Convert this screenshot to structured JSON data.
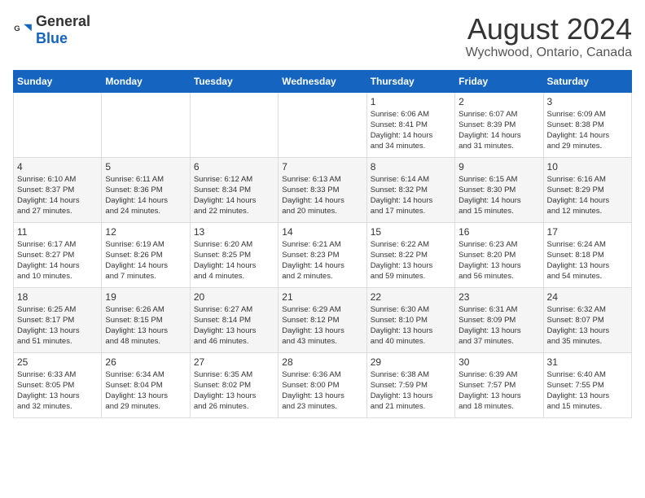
{
  "header": {
    "logo_general": "General",
    "logo_blue": "Blue",
    "main_title": "August 2024",
    "subtitle": "Wychwood, Ontario, Canada"
  },
  "weekdays": [
    "Sunday",
    "Monday",
    "Tuesday",
    "Wednesday",
    "Thursday",
    "Friday",
    "Saturday"
  ],
  "weeks": [
    [
      {
        "day": "",
        "info": ""
      },
      {
        "day": "",
        "info": ""
      },
      {
        "day": "",
        "info": ""
      },
      {
        "day": "",
        "info": ""
      },
      {
        "day": "1",
        "info": "Sunrise: 6:06 AM\nSunset: 8:41 PM\nDaylight: 14 hours\nand 34 minutes."
      },
      {
        "day": "2",
        "info": "Sunrise: 6:07 AM\nSunset: 8:39 PM\nDaylight: 14 hours\nand 31 minutes."
      },
      {
        "day": "3",
        "info": "Sunrise: 6:09 AM\nSunset: 8:38 PM\nDaylight: 14 hours\nand 29 minutes."
      }
    ],
    [
      {
        "day": "4",
        "info": "Sunrise: 6:10 AM\nSunset: 8:37 PM\nDaylight: 14 hours\nand 27 minutes."
      },
      {
        "day": "5",
        "info": "Sunrise: 6:11 AM\nSunset: 8:36 PM\nDaylight: 14 hours\nand 24 minutes."
      },
      {
        "day": "6",
        "info": "Sunrise: 6:12 AM\nSunset: 8:34 PM\nDaylight: 14 hours\nand 22 minutes."
      },
      {
        "day": "7",
        "info": "Sunrise: 6:13 AM\nSunset: 8:33 PM\nDaylight: 14 hours\nand 20 minutes."
      },
      {
        "day": "8",
        "info": "Sunrise: 6:14 AM\nSunset: 8:32 PM\nDaylight: 14 hours\nand 17 minutes."
      },
      {
        "day": "9",
        "info": "Sunrise: 6:15 AM\nSunset: 8:30 PM\nDaylight: 14 hours\nand 15 minutes."
      },
      {
        "day": "10",
        "info": "Sunrise: 6:16 AM\nSunset: 8:29 PM\nDaylight: 14 hours\nand 12 minutes."
      }
    ],
    [
      {
        "day": "11",
        "info": "Sunrise: 6:17 AM\nSunset: 8:27 PM\nDaylight: 14 hours\nand 10 minutes."
      },
      {
        "day": "12",
        "info": "Sunrise: 6:19 AM\nSunset: 8:26 PM\nDaylight: 14 hours\nand 7 minutes."
      },
      {
        "day": "13",
        "info": "Sunrise: 6:20 AM\nSunset: 8:25 PM\nDaylight: 14 hours\nand 4 minutes."
      },
      {
        "day": "14",
        "info": "Sunrise: 6:21 AM\nSunset: 8:23 PM\nDaylight: 14 hours\nand 2 minutes."
      },
      {
        "day": "15",
        "info": "Sunrise: 6:22 AM\nSunset: 8:22 PM\nDaylight: 13 hours\nand 59 minutes."
      },
      {
        "day": "16",
        "info": "Sunrise: 6:23 AM\nSunset: 8:20 PM\nDaylight: 13 hours\nand 56 minutes."
      },
      {
        "day": "17",
        "info": "Sunrise: 6:24 AM\nSunset: 8:18 PM\nDaylight: 13 hours\nand 54 minutes."
      }
    ],
    [
      {
        "day": "18",
        "info": "Sunrise: 6:25 AM\nSunset: 8:17 PM\nDaylight: 13 hours\nand 51 minutes."
      },
      {
        "day": "19",
        "info": "Sunrise: 6:26 AM\nSunset: 8:15 PM\nDaylight: 13 hours\nand 48 minutes."
      },
      {
        "day": "20",
        "info": "Sunrise: 6:27 AM\nSunset: 8:14 PM\nDaylight: 13 hours\nand 46 minutes."
      },
      {
        "day": "21",
        "info": "Sunrise: 6:29 AM\nSunset: 8:12 PM\nDaylight: 13 hours\nand 43 minutes."
      },
      {
        "day": "22",
        "info": "Sunrise: 6:30 AM\nSunset: 8:10 PM\nDaylight: 13 hours\nand 40 minutes."
      },
      {
        "day": "23",
        "info": "Sunrise: 6:31 AM\nSunset: 8:09 PM\nDaylight: 13 hours\nand 37 minutes."
      },
      {
        "day": "24",
        "info": "Sunrise: 6:32 AM\nSunset: 8:07 PM\nDaylight: 13 hours\nand 35 minutes."
      }
    ],
    [
      {
        "day": "25",
        "info": "Sunrise: 6:33 AM\nSunset: 8:05 PM\nDaylight: 13 hours\nand 32 minutes."
      },
      {
        "day": "26",
        "info": "Sunrise: 6:34 AM\nSunset: 8:04 PM\nDaylight: 13 hours\nand 29 minutes."
      },
      {
        "day": "27",
        "info": "Sunrise: 6:35 AM\nSunset: 8:02 PM\nDaylight: 13 hours\nand 26 minutes."
      },
      {
        "day": "28",
        "info": "Sunrise: 6:36 AM\nSunset: 8:00 PM\nDaylight: 13 hours\nand 23 minutes."
      },
      {
        "day": "29",
        "info": "Sunrise: 6:38 AM\nSunset: 7:59 PM\nDaylight: 13 hours\nand 21 minutes."
      },
      {
        "day": "30",
        "info": "Sunrise: 6:39 AM\nSunset: 7:57 PM\nDaylight: 13 hours\nand 18 minutes."
      },
      {
        "day": "31",
        "info": "Sunrise: 6:40 AM\nSunset: 7:55 PM\nDaylight: 13 hours\nand 15 minutes."
      }
    ]
  ]
}
